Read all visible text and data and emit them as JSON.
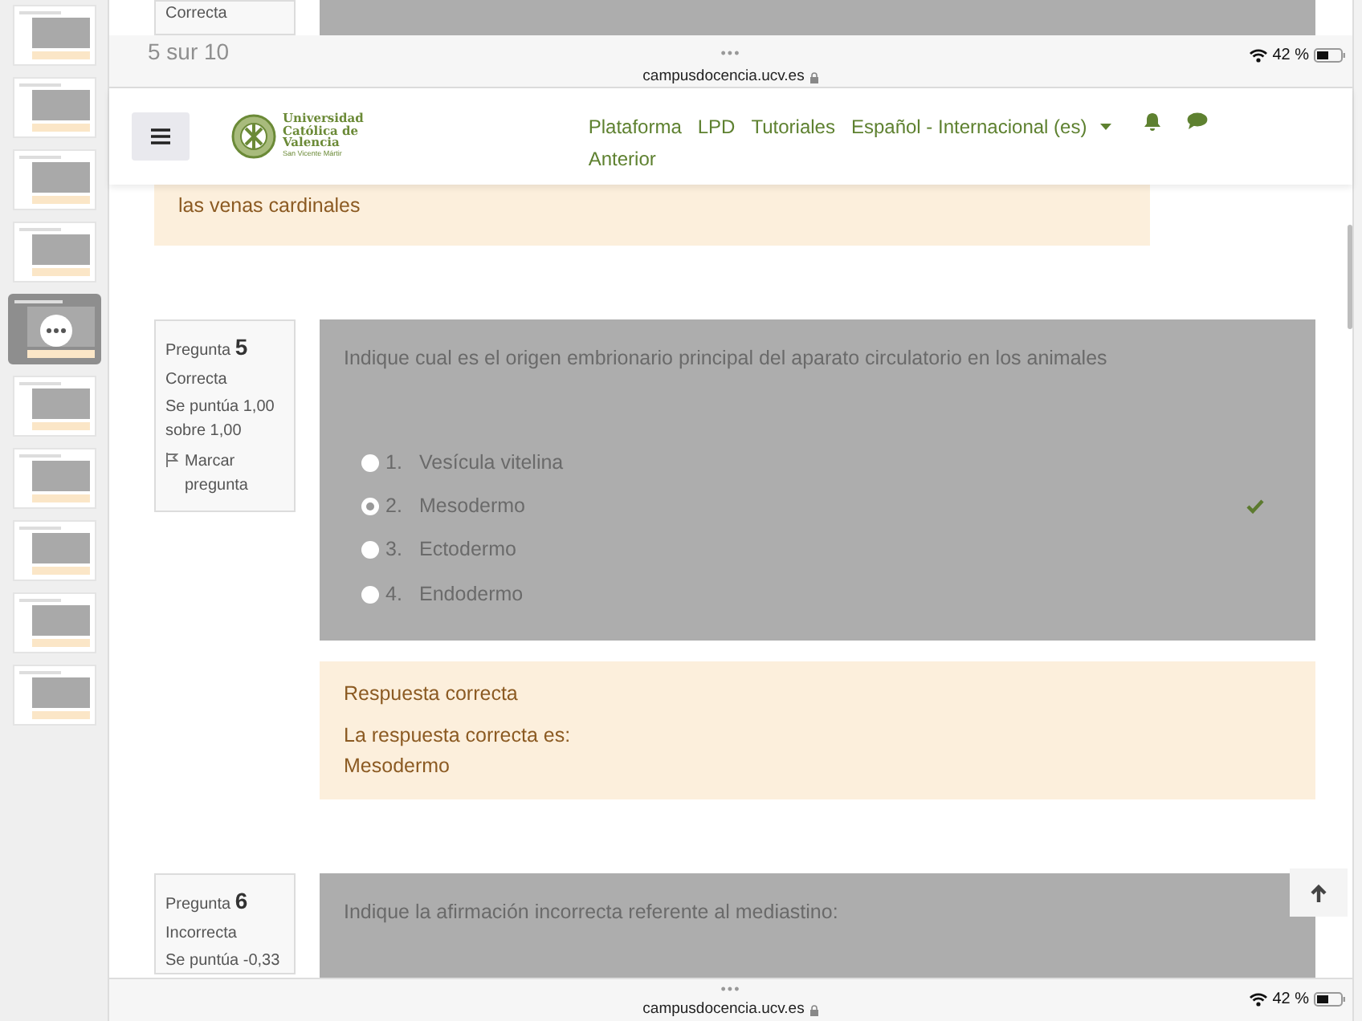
{
  "thumbnails": [
    {
      "selected": false
    },
    {
      "selected": false
    },
    {
      "selected": false
    },
    {
      "selected": false
    },
    {
      "selected": true
    },
    {
      "selected": false
    },
    {
      "selected": false
    },
    {
      "selected": false
    },
    {
      "selected": false
    },
    {
      "selected": false
    }
  ],
  "previous_question": {
    "status": "Correcta"
  },
  "page_indicator": "5 sur 10",
  "browser_bar_top": {
    "dots": "•••",
    "url": "campusdocencia.ucv.es",
    "battery": "42 %"
  },
  "navbar": {
    "logo_lines": [
      "Universidad",
      "Católica de",
      "Valencia"
    ],
    "logo_subtitle": "San Vicente Mártir",
    "links": [
      "Plataforma",
      "LPD",
      "Tutoriales"
    ],
    "language": "Español - Internacional (es)",
    "second_line": "Anterior"
  },
  "feedback_top": "las venas cardinales",
  "questions": [
    {
      "label": "Pregunta",
      "number": "5",
      "status": "Correcta",
      "score": "Se puntúa 1,00 sobre 1,00",
      "flag": "Marcar pregunta",
      "text": "Indique cual es el origen embrionario principal del aparato circulatorio en los animales",
      "options": [
        {
          "number": "1.",
          "label": "Vesícula vitelina",
          "selected": false,
          "correct": false
        },
        {
          "number": "2.",
          "label": "Mesodermo",
          "selected": true,
          "correct": true
        },
        {
          "number": "3.",
          "label": "Ectodermo",
          "selected": false,
          "correct": false
        },
        {
          "number": "4.",
          "label": "Endodermo",
          "selected": false,
          "correct": false
        }
      ],
      "feedback": {
        "title": "Respuesta correcta",
        "lines": [
          "La respuesta correcta es:",
          "Mesodermo"
        ]
      }
    },
    {
      "label": "Pregunta",
      "number": "6",
      "status": "Incorrecta",
      "score": "Se puntúa -0,33",
      "text": "Indique la afirmación incorrecta referente al mediastino:"
    }
  ],
  "browser_bar_bottom": {
    "dots": "•••",
    "url": "campusdocencia.ucv.es",
    "battery": "42 %"
  }
}
